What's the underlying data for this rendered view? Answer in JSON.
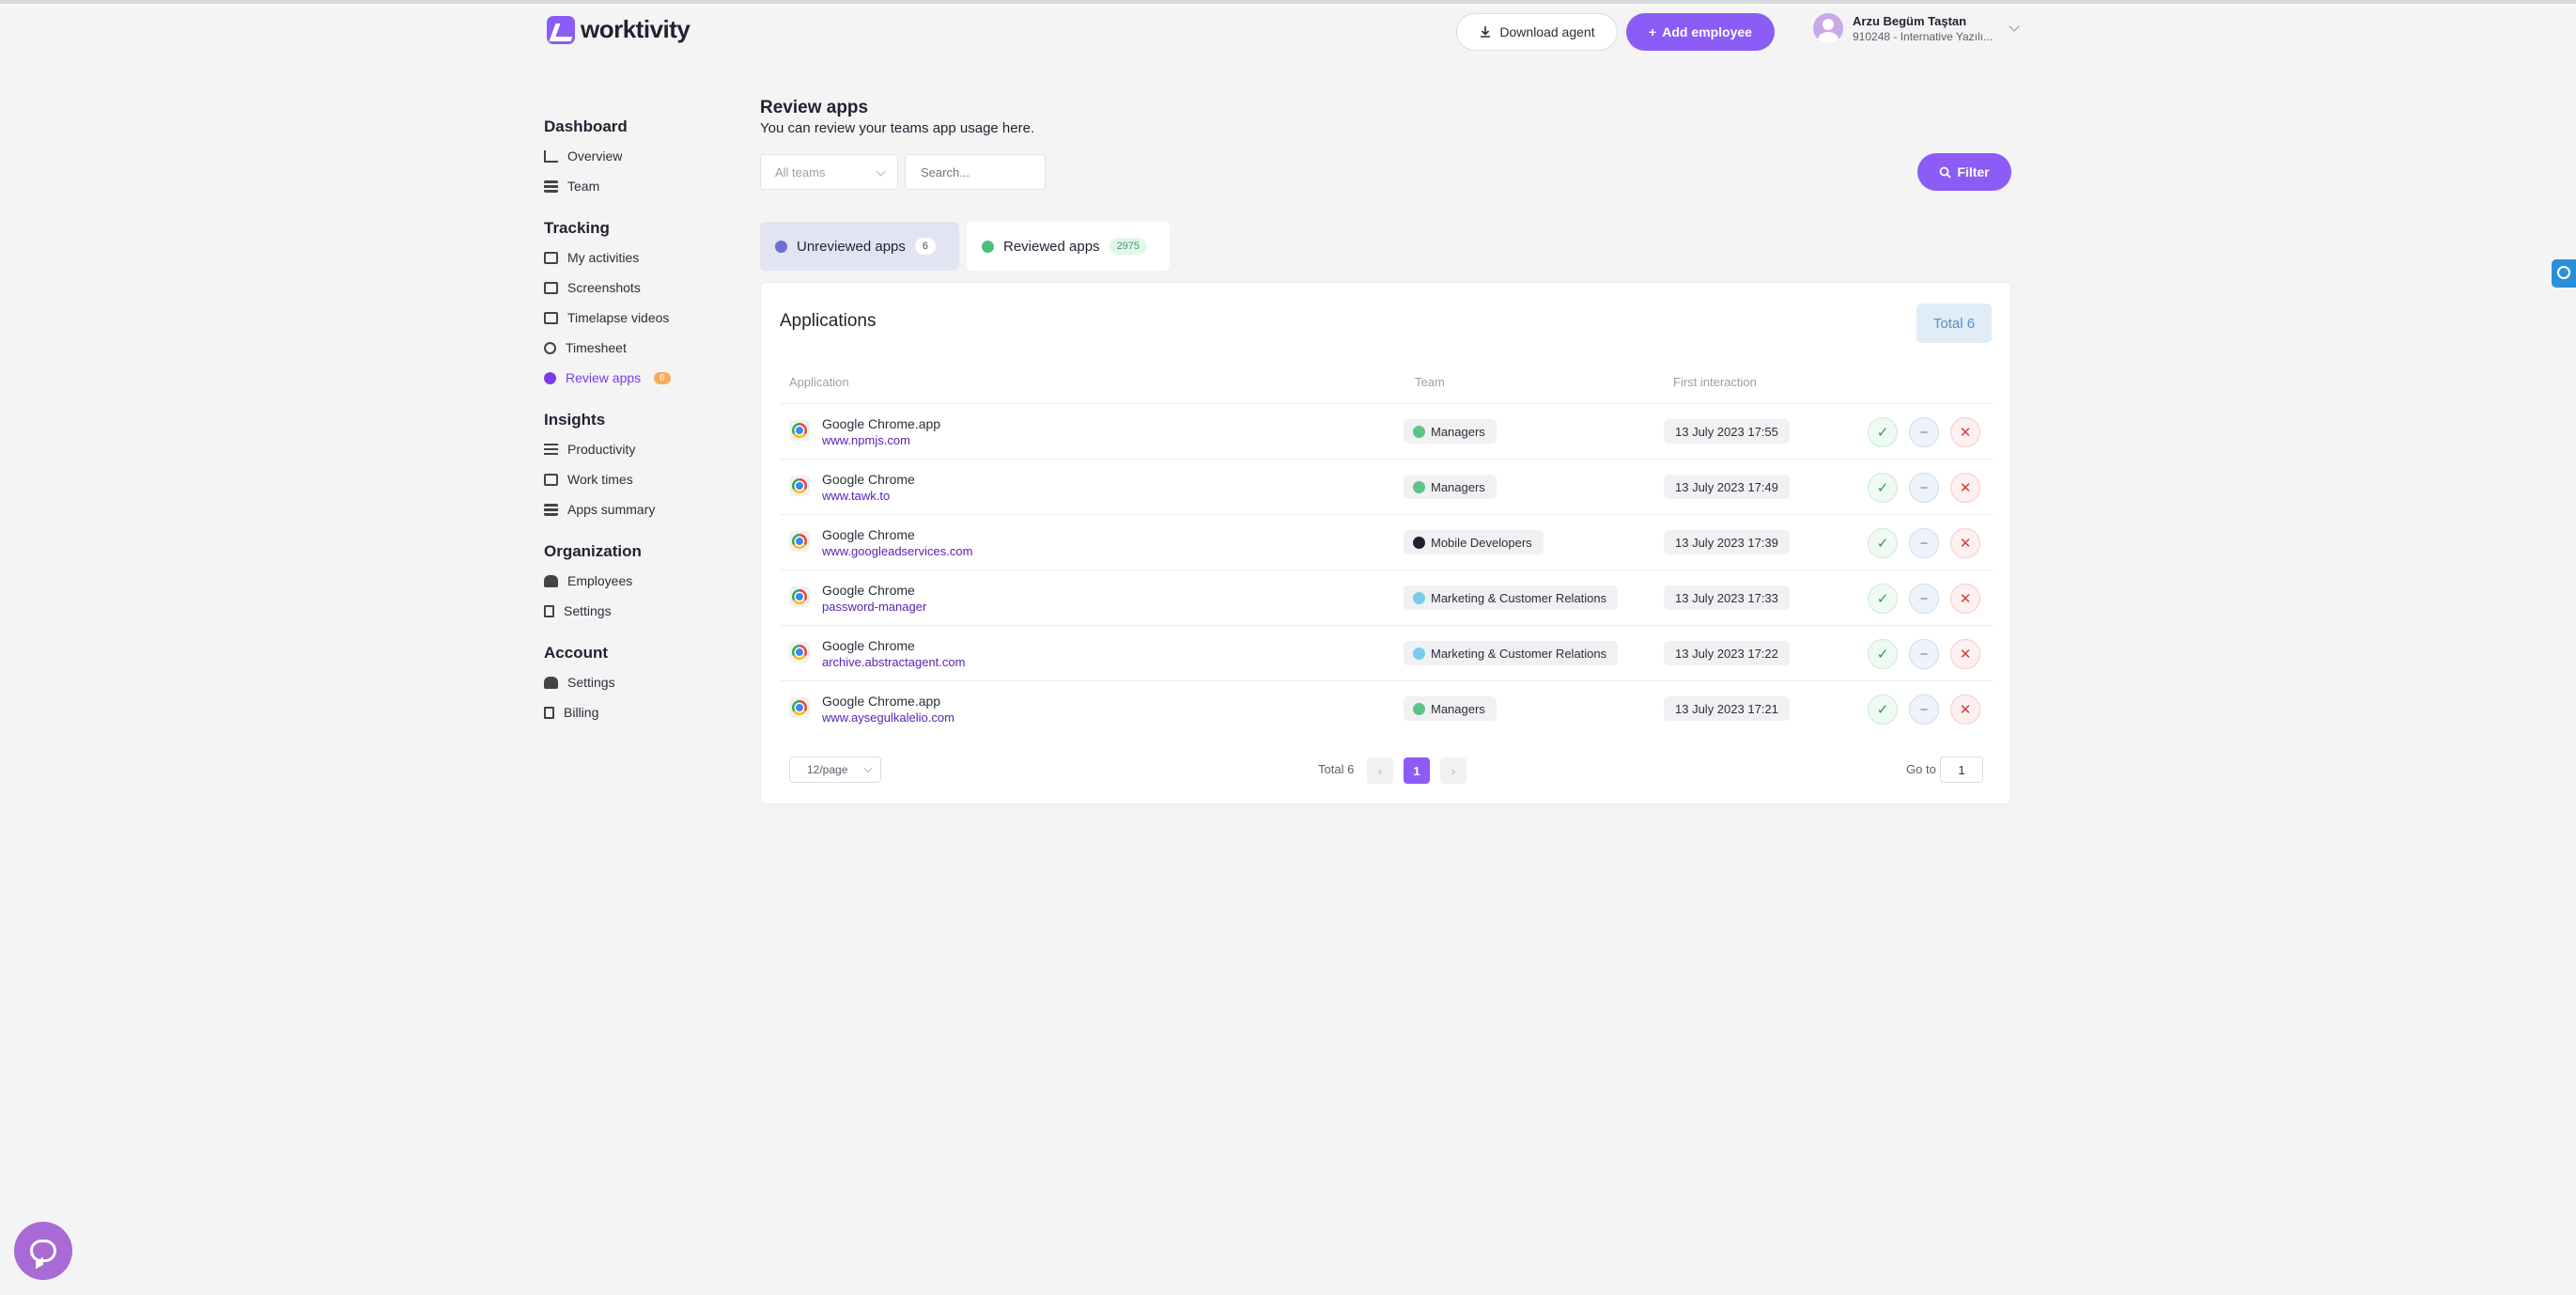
{
  "brand": {
    "name": "worktivity",
    "accent": "#8b5cf6"
  },
  "header": {
    "download_label": "Download agent",
    "add_employee_label": "Add employee",
    "user_name": "Arzu Begüm Taştan",
    "user_org": "910248 - Internative Yazılı..."
  },
  "sidebar": {
    "sections": [
      {
        "title": "Dashboard",
        "items": [
          "Overview",
          "Team"
        ]
      },
      {
        "title": "Tracking",
        "items": [
          "My activities",
          "Screenshots",
          "Timelapse videos",
          "Timesheet",
          "Review apps"
        ]
      },
      {
        "title": "Insights",
        "items": [
          "Productivity",
          "Work times",
          "Apps summary"
        ]
      },
      {
        "title": "Organization",
        "items": [
          "Employees",
          "Settings"
        ]
      },
      {
        "title": "Account",
        "items": [
          "Settings",
          "Billing"
        ]
      }
    ],
    "review_badge": "6"
  },
  "page": {
    "title": "Review apps",
    "subtitle": "You can review your teams app usage here."
  },
  "filters": {
    "teams_placeholder": "All teams",
    "search_placeholder": "Search...",
    "filter_label": "Filter"
  },
  "tabs": {
    "unreviewed_label": "Unreviewed apps",
    "unreviewed_count": "6",
    "reviewed_label": "Reviewed apps",
    "reviewed_count": "2975"
  },
  "table": {
    "title": "Applications",
    "total_label": "Total 6",
    "columns": [
      "Application",
      "Team",
      "First interaction"
    ],
    "rows": [
      {
        "app": "Google Chrome.app",
        "url": "www.npmjs.com",
        "team": "Managers",
        "team_color": "#5cc488",
        "date": "13 July 2023 17:55"
      },
      {
        "app": "Google Chrome",
        "url": "www.tawk.to",
        "team": "Managers",
        "team_color": "#5cc488",
        "date": "13 July 2023 17:49"
      },
      {
        "app": "Google Chrome",
        "url": "www.googleadservices.com",
        "team": "Mobile Developers",
        "team_color": "#1f2330",
        "date": "13 July 2023 17:39"
      },
      {
        "app": "Google Chrome",
        "url": "password-manager",
        "team": "Marketing & Customer Relations",
        "team_color": "#7ccbef",
        "date": "13 July 2023 17:33"
      },
      {
        "app": "Google Chrome",
        "url": "archive.abstractagent.com",
        "team": "Marketing & Customer Relations",
        "team_color": "#7ccbef",
        "date": "13 July 2023 17:22"
      },
      {
        "app": "Google Chrome.app",
        "url": "www.aysegulkalelio.com",
        "team": "Managers",
        "team_color": "#5cc488",
        "date": "13 July 2023 17:21"
      }
    ]
  },
  "pagination": {
    "per_page": "12/page",
    "total": "Total 6",
    "current_page": "1",
    "goto_label": "Go to",
    "goto_value": "1"
  }
}
